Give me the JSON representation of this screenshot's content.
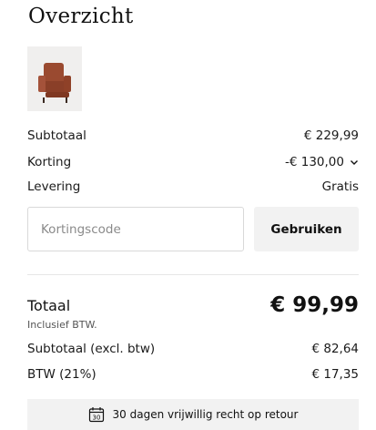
{
  "summary": {
    "title": "Overzicht",
    "product_image": "recliner-chair-thumbnail",
    "rows": {
      "subtotal": {
        "label": "Subtotaal",
        "value": "€ 229,99"
      },
      "discount": {
        "label": "Korting",
        "value": "-€ 130,00"
      },
      "delivery": {
        "label": "Levering",
        "value": "Gratis"
      }
    },
    "coupon": {
      "placeholder": "Kortingscode",
      "value": "",
      "apply_label": "Gebruiken"
    },
    "total": {
      "label": "Totaal",
      "value": "€ 99,99",
      "vat_note": "Inclusief BTW."
    },
    "breakdown": {
      "excl": {
        "label": "Subtotaal (excl. btw)",
        "value": "€ 82,64"
      },
      "vat": {
        "label": "BTW (21%)",
        "value": "€ 17,35"
      }
    },
    "returns": {
      "icon": "calendar-icon",
      "icon_text": "30",
      "text": "30 dagen vrijwillig recht op retour"
    }
  }
}
